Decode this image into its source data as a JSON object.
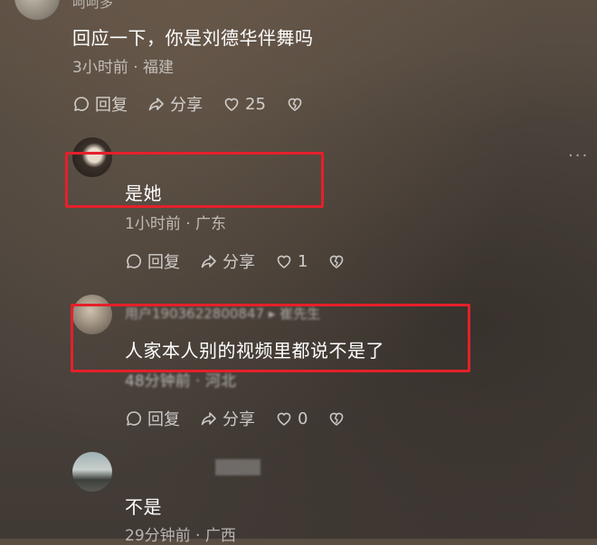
{
  "comments": [
    {
      "username": "呵呵多",
      "text": "回应一下，你是刘德华伴舞吗",
      "time": "3小时前",
      "location": "福建",
      "reply_label": "回复",
      "share_label": "分享",
      "like_count": "25"
    },
    {
      "username": "",
      "text": "是她",
      "time": "1小时前",
      "location": "广东",
      "reply_label": "回复",
      "share_label": "分享",
      "like_count": "1"
    },
    {
      "username": "用户1903622800847",
      "reply_to": "崔先生",
      "text": "人家本人别的视频里都说不是了",
      "time": "48分钟前",
      "location": "河北",
      "reply_label": "回复",
      "share_label": "分享",
      "like_count": "0"
    },
    {
      "username": "",
      "text": "不是",
      "time": "29分钟前",
      "location": "广西"
    }
  ],
  "separator": " · ",
  "more_glyph": "···",
  "colors": {
    "highlight_box": "#e5202a",
    "text": "#ffffff"
  },
  "icons": [
    "reply-icon",
    "share-icon",
    "heart-icon",
    "broken-heart-icon",
    "more-icon"
  ]
}
